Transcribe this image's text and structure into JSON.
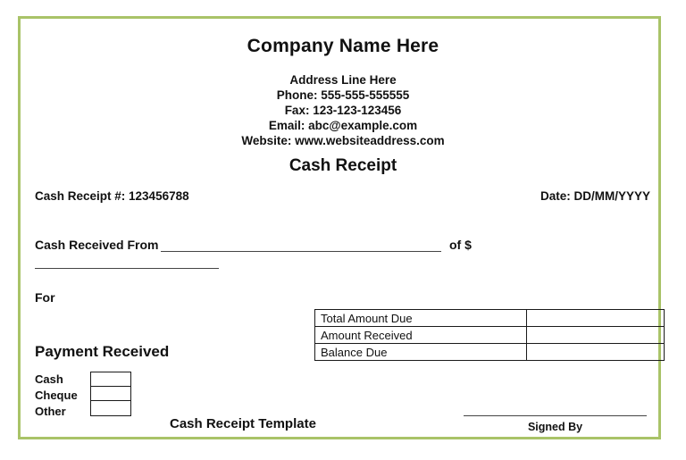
{
  "document": {
    "type": "cash-receipt-template",
    "border_color": "#a9c368",
    "background_color": "#ffffff",
    "text_color": "#111111"
  },
  "header": {
    "company_name": "Company Name Here",
    "contact_lines": [
      "Address Line Here",
      "Phone: 555-555-555555",
      "Fax: 123-123-123456",
      "Email: abc@example.com",
      "Website: www.websiteaddress.com"
    ],
    "doc_title": "Cash Receipt"
  },
  "meta_row": {
    "receipt_number": "Cash Receipt #: 123456788",
    "date": "Date: DD/MM/YYYY"
  },
  "received_from": {
    "label": "Cash Received From",
    "value": "",
    "amount_label": "of $",
    "amount_value": ""
  },
  "for_section": {
    "label": "For",
    "value": ""
  },
  "amounts_table": {
    "rows": [
      {
        "label": "Total Amount Due",
        "value": ""
      },
      {
        "label": "Amount Received",
        "value": ""
      },
      {
        "label": "Balance Due",
        "value": ""
      }
    ]
  },
  "payment_received": {
    "heading": "Payment Received",
    "methods": [
      {
        "label": "Cash",
        "checked": ""
      },
      {
        "label": "Cheque",
        "checked": ""
      },
      {
        "label": "Other",
        "checked": ""
      }
    ]
  },
  "footer": {
    "title": "Cash Receipt Template",
    "signed_by_label": "Signed By",
    "signature_value": ""
  }
}
